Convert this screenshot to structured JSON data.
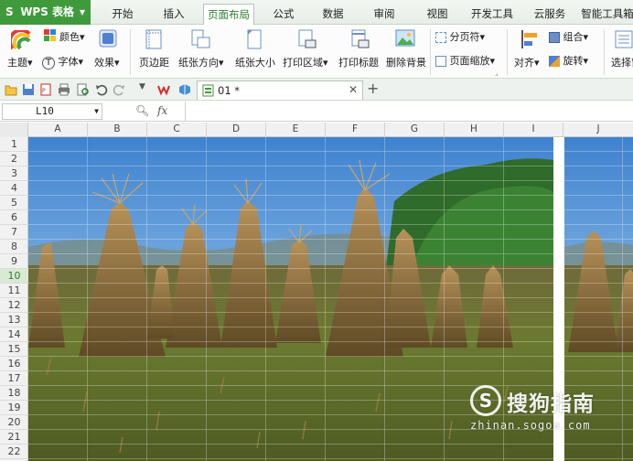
{
  "app": {
    "name": "WPS 表格",
    "logo": "S"
  },
  "menu": {
    "tabs": [
      "开始",
      "插入",
      "页面布局",
      "公式",
      "数据",
      "审阅",
      "视图",
      "开发工具",
      "云服务",
      "智能工具箱"
    ],
    "active": "页面布局"
  },
  "ribbon": {
    "theme": "主题",
    "colors": "颜色",
    "fonts": "字体",
    "effects": "效果",
    "margins": "页边距",
    "orientation": "纸张方向",
    "size": "纸张大小",
    "print_area": "打印区域",
    "print_titles": "打印标题",
    "delete_background": "删除背景",
    "page_break": "分页符",
    "page_zoom": "页面缩放",
    "align": "对齐",
    "group": "组合",
    "rotate": "旋转",
    "selection": "选择窗"
  },
  "document": {
    "tab_title": "01 *"
  },
  "formula_bar": {
    "cell_ref": "L10",
    "fx": "fx",
    "value": ""
  },
  "columns": [
    "A",
    "B",
    "C",
    "D",
    "E",
    "F",
    "G",
    "H",
    "I",
    "J"
  ],
  "rows": [
    "1",
    "2",
    "3",
    "4",
    "5",
    "6",
    "7",
    "8",
    "9",
    "10",
    "11",
    "12",
    "13",
    "14",
    "15",
    "16",
    "17",
    "18",
    "19",
    "20",
    "21",
    "22"
  ],
  "active_row": "10",
  "watermark": {
    "brand": "搜狗指南",
    "url": "zhinan.sogou.com",
    "mark": "S"
  },
  "colors": {
    "accent": "#3f9a3c",
    "sky": "#7fb2e0",
    "straw": "#8a6a32",
    "grass": "#5d7a2e"
  }
}
